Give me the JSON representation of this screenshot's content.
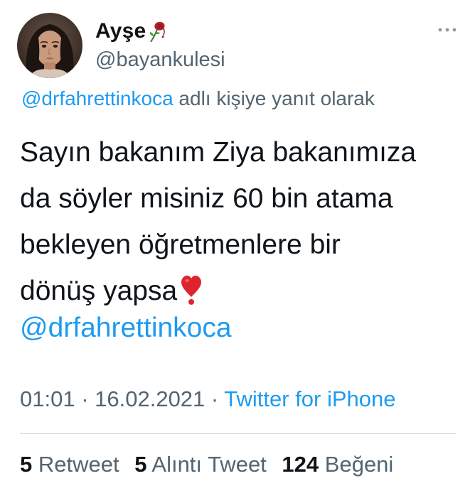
{
  "author": {
    "display_name": "Ayşe",
    "handle": "@bayankulesi",
    "avatar_icon": "profile-photo",
    "name_emoji_icon": "wilted-rose-icon"
  },
  "reply_context": {
    "mention": "@drfahrettinkoca",
    "suffix": " adlı kişiye yanıt olarak"
  },
  "tweet": {
    "lines": [
      "Sayın bakanım Ziya bakanımıza",
      "da söyler misiniz 60 bin atama",
      "bekleyen öğretmenlere bir",
      "dönüş yapsa"
    ],
    "trailing_emoji_icon": "red-heart-exclamation-icon",
    "mention": "@drfahrettinkoca"
  },
  "meta": {
    "time": "01:01",
    "separator": " · ",
    "date": "16.02.2021",
    "source": "Twitter for iPhone"
  },
  "stats": {
    "retweets_count": "5",
    "retweets_label": "Retweet",
    "quotes_count": "5",
    "quotes_label": "Alıntı Tweet",
    "likes_count": "124",
    "likes_label": "Beğeni"
  },
  "colors": {
    "text": "#0f1419",
    "secondary": "#536471",
    "link": "#1d9bf0",
    "divider": "#cfd9de"
  }
}
